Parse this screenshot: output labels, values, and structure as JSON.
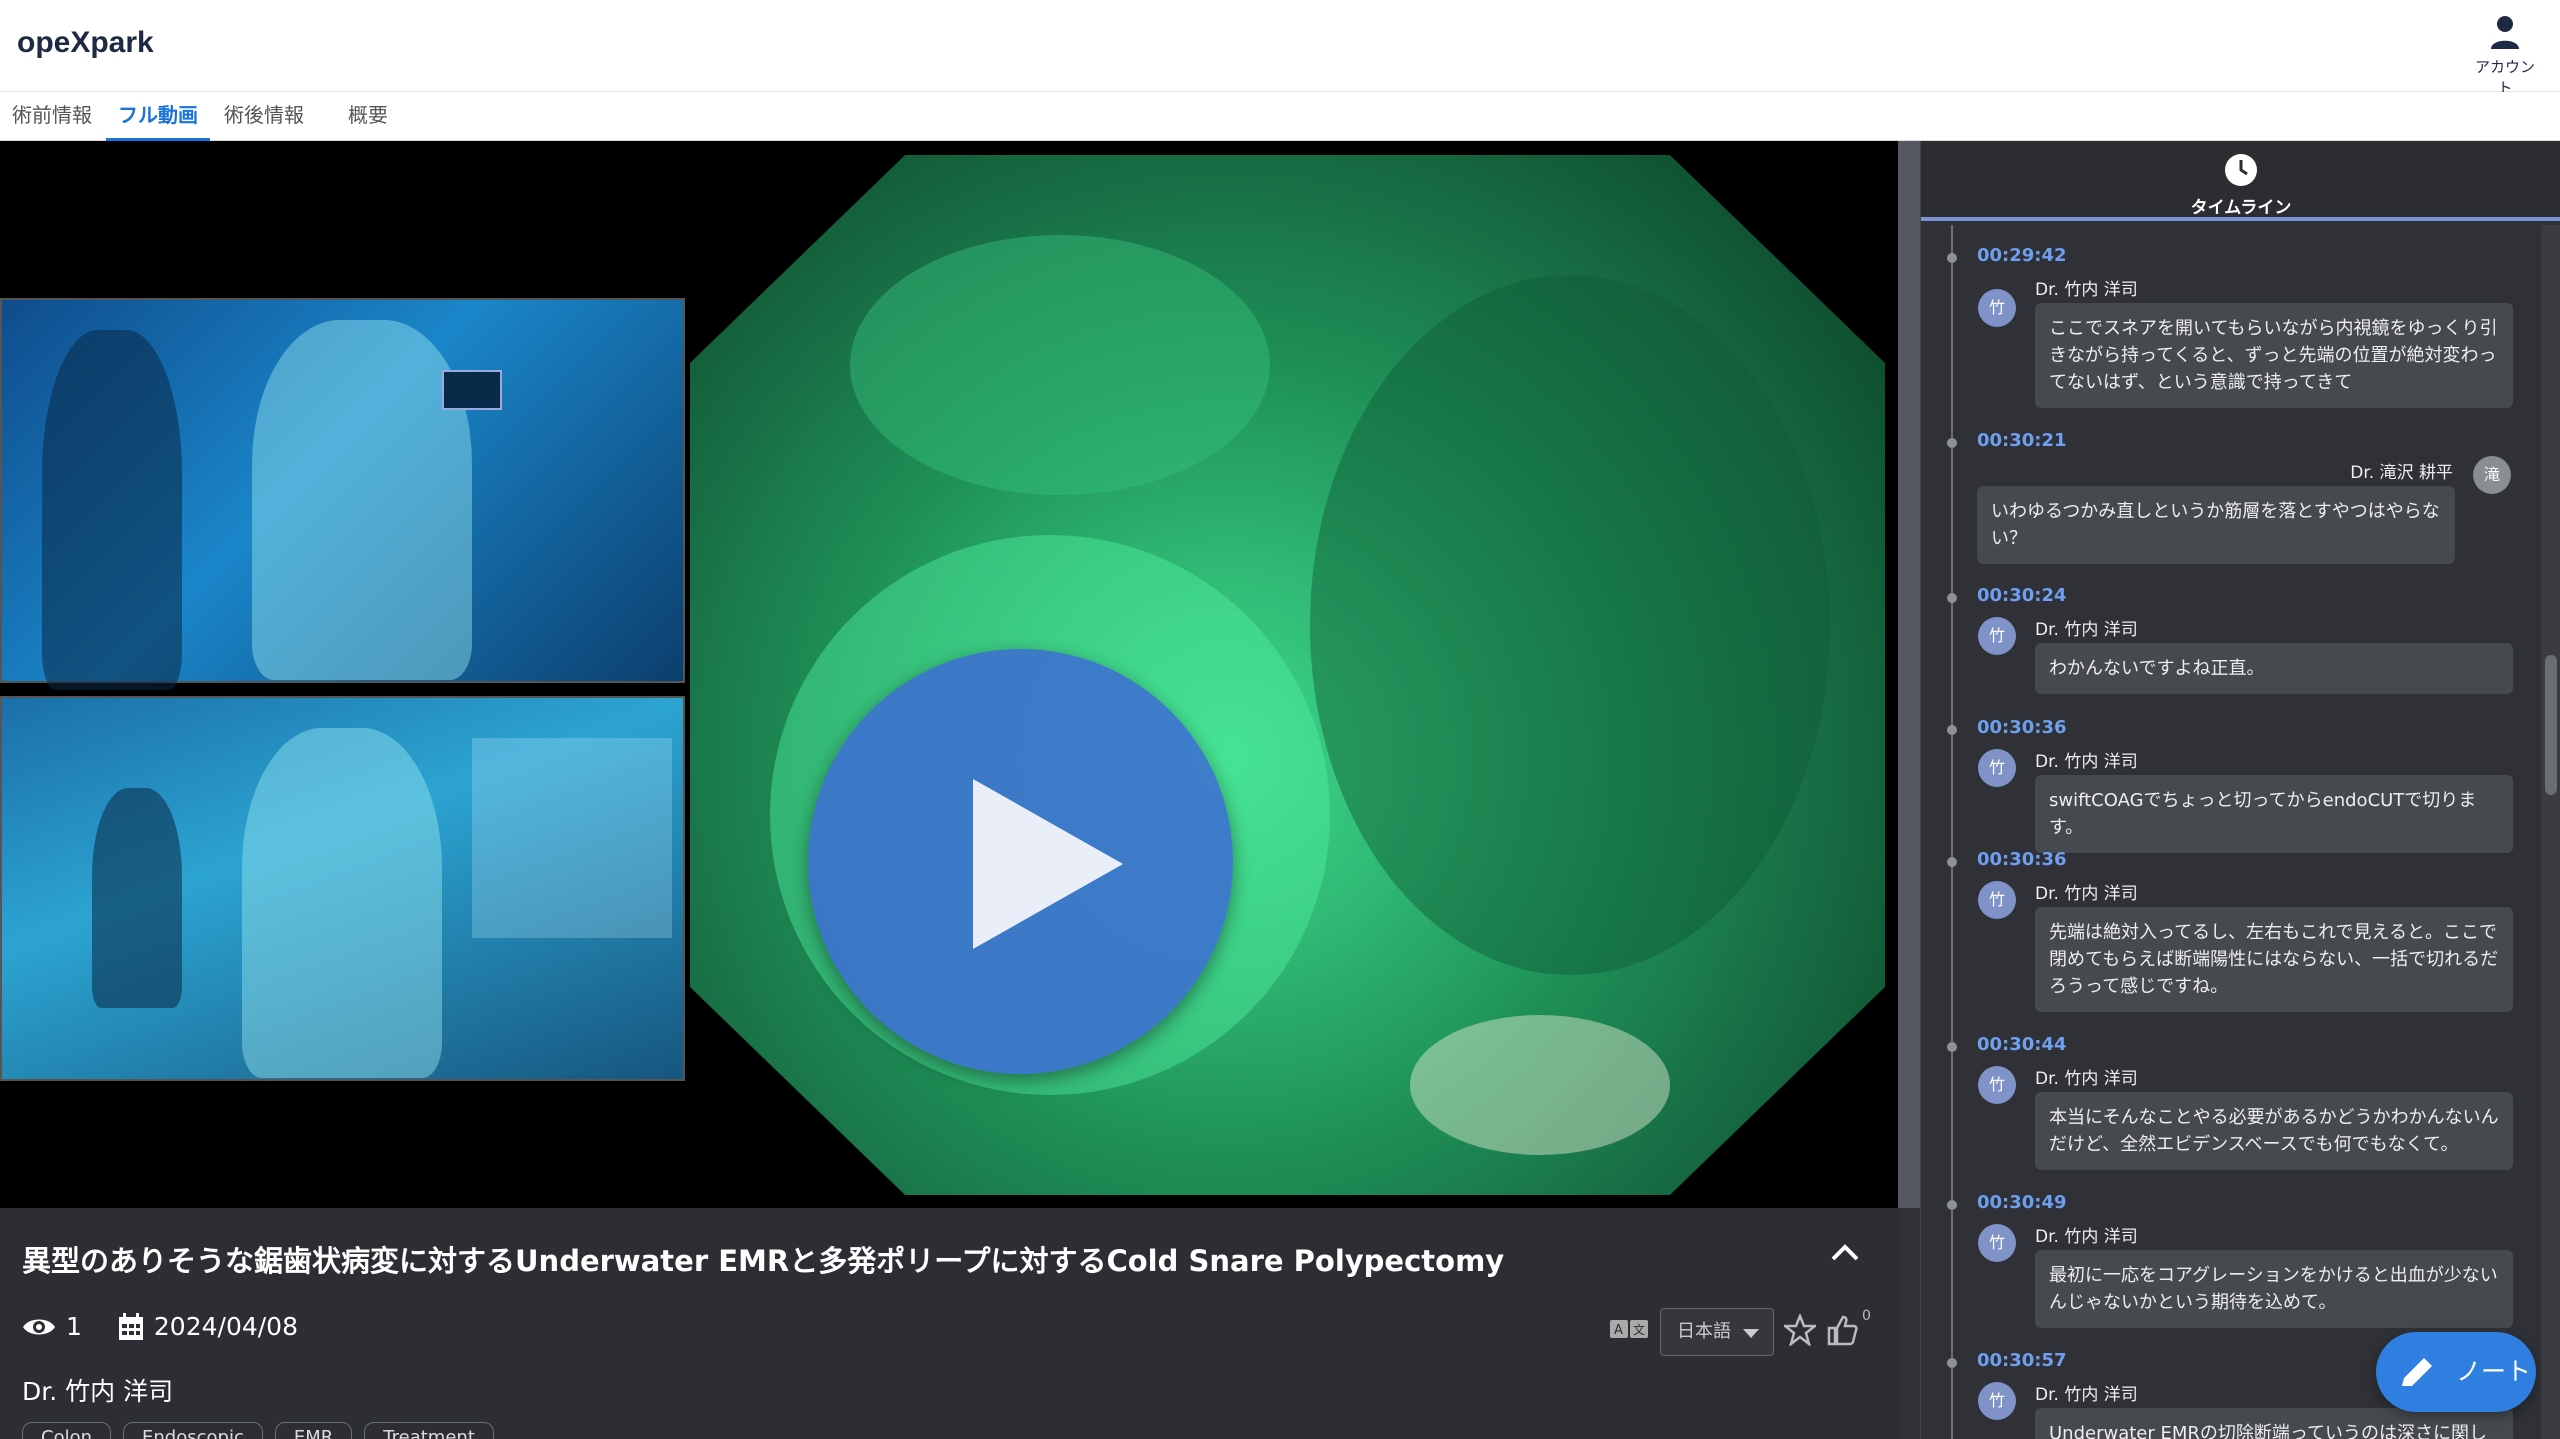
{
  "app": {
    "logo": "opeXpark",
    "account_label": "アカウント"
  },
  "tabs": [
    {
      "label": "術前情報"
    },
    {
      "label": "フル動画"
    },
    {
      "label": "術後情報"
    },
    {
      "label": "概要"
    }
  ],
  "video": {
    "title": "異型のありそうな鋸歯状病変に対するUnderwater EMRと多発ポリープに対するCold Snare Polypectomy",
    "views": "1",
    "date": "2024/04/08",
    "author": "Dr. 竹内 洋司",
    "tags": [
      "Colon",
      "Endoscopic",
      "EMR",
      "Treatment"
    ],
    "language": "日本語",
    "like_count": "0"
  },
  "timeline": {
    "header": "タイムライン",
    "entries": [
      {
        "time": "00:29:42",
        "avatar": "竹",
        "name": "Dr. 竹内 洋司",
        "text": "ここでスネアを開いてもらいながら内視鏡をゆっくり引きながら持ってくると、ずっと先端の位置が絶対変わってないはず、という意識で持ってきて"
      },
      {
        "time": "00:30:21",
        "avatar": "滝",
        "name": "Dr. 滝沢 耕平",
        "text": "いわゆるつかみ直しというか筋層を落とすやつはやらない？"
      },
      {
        "time": "00:30:24",
        "avatar": "竹",
        "name": "Dr. 竹内 洋司",
        "text": "わかんないですよね正直。"
      },
      {
        "time": "00:30:36",
        "avatar": "竹",
        "name": "Dr. 竹内 洋司",
        "text": "swiftCOAGでちょっと切ってからendoCUTで切ります。"
      },
      {
        "time": "00:30:36",
        "avatar": "竹",
        "name": "Dr. 竹内 洋司",
        "text": "先端は絶対入ってるし、左右もこれで見えると。ここで閉めてもらえば断端陽性にはならない、一括で切れるだろうって感じですね。"
      },
      {
        "time": "00:30:44",
        "avatar": "竹",
        "name": "Dr. 竹内 洋司",
        "text": "本当にそんなことやる必要があるかどうかわかんないんだけど、全然エビデンスベースでも何でもなくて。"
      },
      {
        "time": "00:30:49",
        "avatar": "竹",
        "name": "Dr. 竹内 洋司",
        "text": "最初に一応をコアグレーションをかけると出血が少ないんじゃないかという期待を込めて。"
      },
      {
        "time": "00:30:57",
        "avatar": "竹",
        "name": "Dr. 竹内 洋司",
        "text": "Underwater EMRの切除断端っていうのは深さに関して"
      }
    ]
  },
  "note_button": {
    "label": "ノート"
  }
}
